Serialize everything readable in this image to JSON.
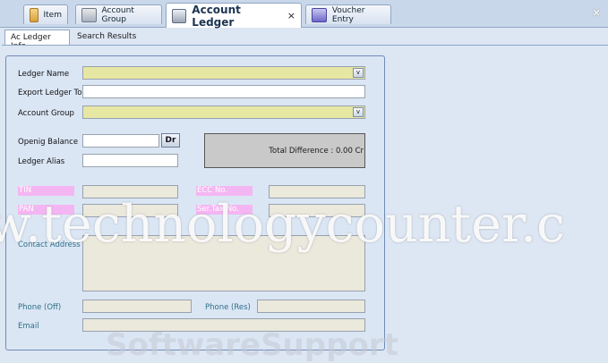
{
  "doc_tabs": [
    {
      "label": "Item",
      "icon": "item-icon"
    },
    {
      "label": "Account Group",
      "icon": "account-group-icon"
    },
    {
      "label": "Account Ledger",
      "icon": "ledger-icon",
      "close": "×"
    },
    {
      "label": "Voucher Entry",
      "icon": "voucher-icon"
    }
  ],
  "window_close": "×",
  "inner_tabs": [
    {
      "label": "Ac Ledger Info"
    },
    {
      "label": "Search Results"
    }
  ],
  "form": {
    "ledger_name_label": "Ledger Name",
    "export_ledger_label": "Export Ledger To",
    "account_group_label": "Account Group",
    "opening_balance_label": "Openig Balance",
    "dr_cr_button": "Dr",
    "ledger_alias_label": "Ledger Alias",
    "total_difference": "Total Difference : 0.00 Cr",
    "tin_label": "TIN",
    "ecc_label": "ECC No.",
    "pan_label": "PAN",
    "sertax_label": "Ser.Tax No.",
    "contact_address_label": "Contact Address",
    "phone_off_label": "Phone (Off)",
    "phone_res_label": "Phone (Res)",
    "email_label": "Email",
    "dropdown_arrow": "v"
  },
  "watermark": "w.technologycounter.c",
  "watermark_bottom": "SoftwareSupport"
}
